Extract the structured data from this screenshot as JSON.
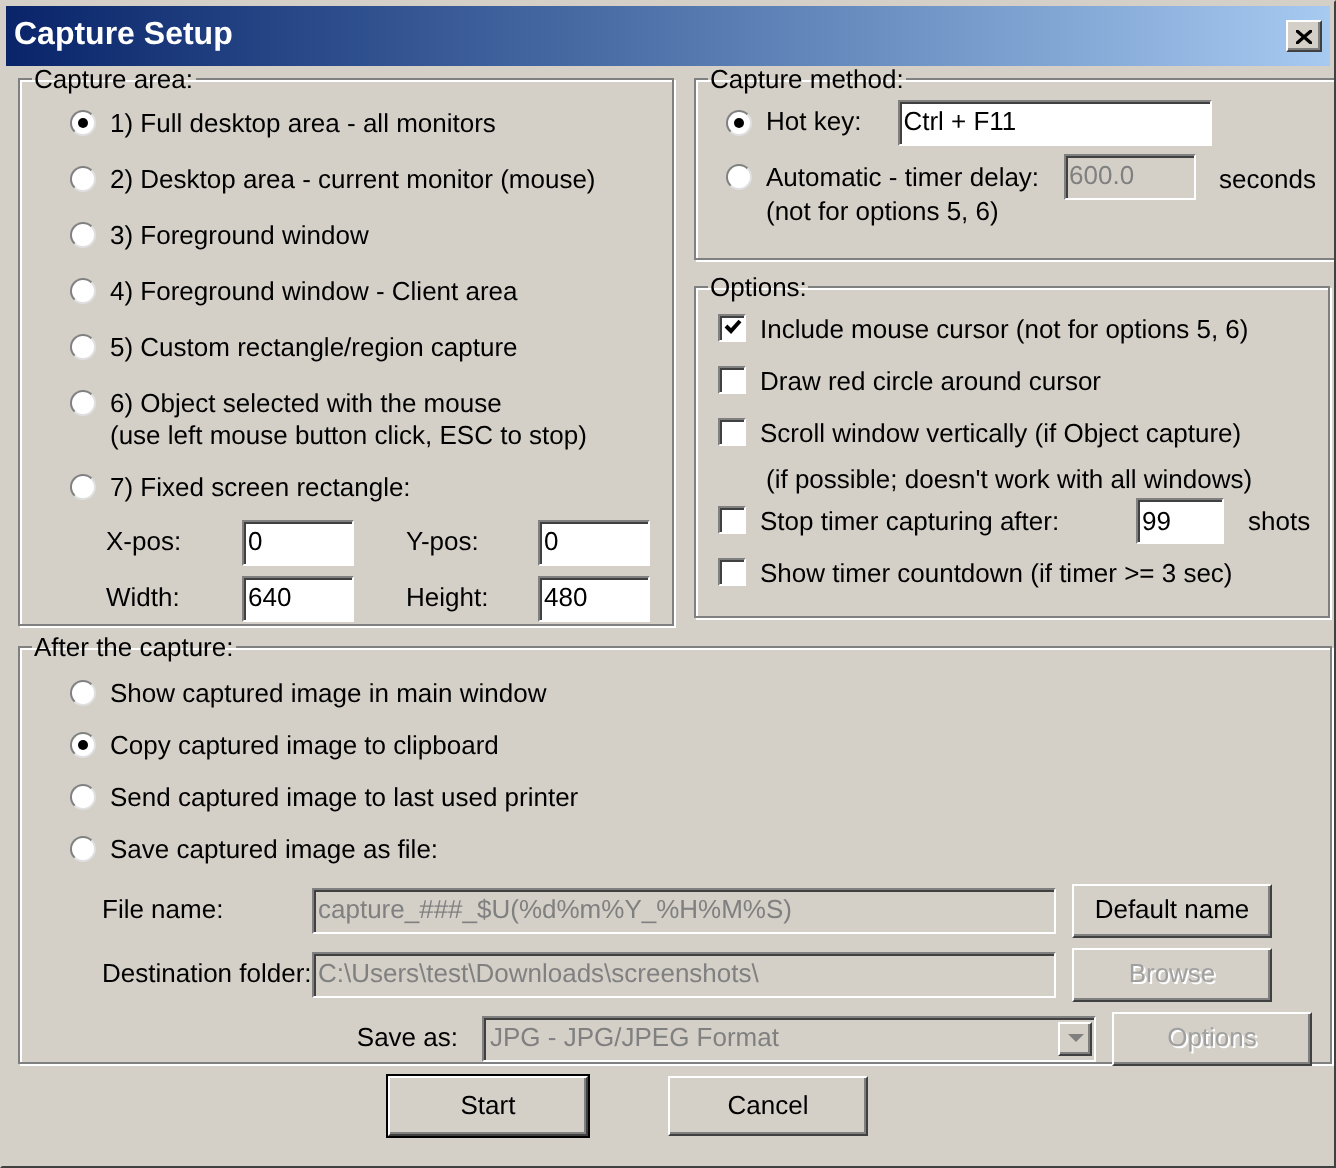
{
  "window": {
    "title": "Capture Setup"
  },
  "capture_area": {
    "title": "Capture area:",
    "options": [
      {
        "label": "1) Full desktop area - all monitors",
        "selected": true
      },
      {
        "label": "2) Desktop area - current monitor (mouse)",
        "selected": false
      },
      {
        "label": "3) Foreground window",
        "selected": false
      },
      {
        "label": "4) Foreground window - Client area",
        "selected": false
      },
      {
        "label": "5) Custom rectangle/region capture",
        "selected": false
      },
      {
        "label": "6) Object selected with the mouse",
        "note": "(use left mouse button click, ESC to stop)",
        "selected": false
      },
      {
        "label": "7) Fixed screen rectangle:",
        "selected": false
      }
    ],
    "fields": [
      {
        "label": "X-pos:",
        "value": "0"
      },
      {
        "label": "Y-pos:",
        "value": "0"
      },
      {
        "label": "Width:",
        "value": "640"
      },
      {
        "label": "Height:",
        "value": "480"
      }
    ]
  },
  "capture_method": {
    "title": "Capture method:",
    "options": [
      {
        "kind": "hotkey",
        "label": "Hot key:",
        "selected": true,
        "value": "Ctrl + F11",
        "disabled": false
      },
      {
        "kind": "timer",
        "label": "Automatic - timer delay:",
        "note": "(not for options 5, 6)",
        "selected": false,
        "value": "600.0",
        "disabled": true,
        "unit": "seconds"
      }
    ]
  },
  "options": {
    "title": "Options:",
    "items": [
      {
        "kind": "check",
        "label": "Include mouse cursor (not for options 5, 6)",
        "checked": true
      },
      {
        "kind": "check",
        "label": "Draw red circle around cursor",
        "checked": false
      },
      {
        "kind": "check",
        "label": "Scroll window vertically (if Object capture)",
        "note": "(if possible; doesn't work with all windows)",
        "checked": false
      },
      {
        "kind": "count",
        "label": "Stop timer capturing after:",
        "checked": false,
        "value": "99",
        "unit": "shots"
      },
      {
        "kind": "check",
        "label": "Show timer countdown (if timer >= 3 sec)",
        "checked": false
      }
    ]
  },
  "after_capture": {
    "title": "After the capture:",
    "options": [
      {
        "label": "Show captured image in main window",
        "selected": false
      },
      {
        "label": "Copy captured image to clipboard",
        "selected": true
      },
      {
        "label": "Send captured image to last used printer",
        "selected": false
      },
      {
        "label": "Save captured image as file:",
        "selected": false
      }
    ],
    "fields": [
      {
        "kind": "text",
        "label": "File name:",
        "value": "capture_###_$U(%d%m%Y_%H%M%S)",
        "disabled": true,
        "button": {
          "label": "Default name",
          "disabled": false
        }
      },
      {
        "kind": "text",
        "label": "Destination folder:",
        "value": "C:\\Users\\test\\Downloads\\screenshots\\",
        "disabled": true,
        "button": {
          "label": "Browse",
          "disabled": true
        }
      },
      {
        "kind": "select",
        "label": "Save as:",
        "value": "JPG - JPG/JPEG Format",
        "disabled": true,
        "button": {
          "label": "Options",
          "disabled": true
        }
      }
    ]
  },
  "buttons": [
    {
      "label": "Start",
      "default": true
    },
    {
      "label": "Cancel",
      "default": false
    }
  ]
}
